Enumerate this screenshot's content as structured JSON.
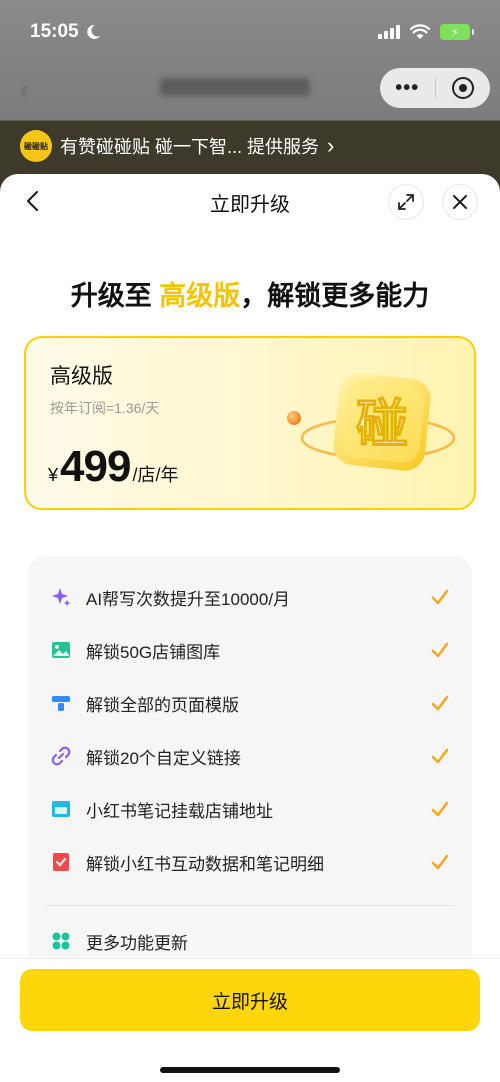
{
  "status_bar": {
    "time": "15:05"
  },
  "provider_bar": {
    "logo_text": "碰碰贴",
    "text": "有赞碰碰贴 碰一下智... 提供服务",
    "chevron": "›"
  },
  "sheet": {
    "title": "立即升级",
    "headline": {
      "prefix": "升级至 ",
      "accent": "高级版",
      "suffix": "，解锁更多能力"
    },
    "plan": {
      "name": "高级版",
      "subtitle": "按年订阅=1.36/天",
      "currency": "¥",
      "price": "499",
      "unit": "/店/年",
      "badge_char": "碰"
    },
    "features": [
      {
        "label": "AI帮写次数提升至10000/月",
        "icon": "sparkle-icon"
      },
      {
        "label": "解锁50G店铺图库",
        "icon": "image-icon"
      },
      {
        "label": "解锁全部的页面模版",
        "icon": "template-icon"
      },
      {
        "label": "解锁20个自定义链接",
        "icon": "link-icon"
      },
      {
        "label": "小红书笔记挂载店铺地址",
        "icon": "store-icon"
      },
      {
        "label": "解锁小红书互动数据和笔记明细",
        "icon": "note-icon"
      }
    ],
    "more_features": {
      "label": "更多功能更新",
      "icon": "grid-icon"
    },
    "cta_label": "立即升级"
  },
  "colors": {
    "accent": "#f3c400",
    "cta": "#ffd60a",
    "check": "#f5a623"
  }
}
